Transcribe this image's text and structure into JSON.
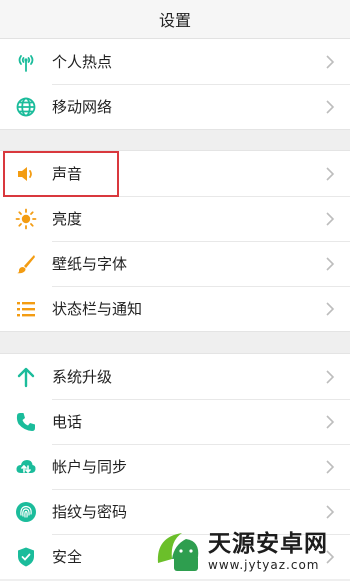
{
  "header": {
    "title": "设置"
  },
  "group1": [
    {
      "label": "个人热点",
      "icon": "hotspot-icon"
    },
    {
      "label": "移动网络",
      "icon": "globe-icon"
    }
  ],
  "group2": [
    {
      "label": "声音",
      "icon": "speaker-icon",
      "highlighted": true
    },
    {
      "label": "亮度",
      "icon": "sun-icon"
    },
    {
      "label": "壁纸与字体",
      "icon": "brush-icon"
    },
    {
      "label": "状态栏与通知",
      "icon": "list-icon"
    }
  ],
  "group3": [
    {
      "label": "系统升级",
      "icon": "arrow-up-icon"
    },
    {
      "label": "电话",
      "icon": "phone-icon"
    },
    {
      "label": "帐户与同步",
      "icon": "cloud-sync-icon"
    },
    {
      "label": "指纹与密码",
      "icon": "fingerprint-icon"
    },
    {
      "label": "安全",
      "icon": "shield-icon"
    }
  ],
  "colors": {
    "teal": "#1bbc9b",
    "orange": "#f39c12",
    "highlight": "#d9383d"
  },
  "watermark": {
    "title": "天源安卓网",
    "url": "www.jytyaz.com"
  }
}
